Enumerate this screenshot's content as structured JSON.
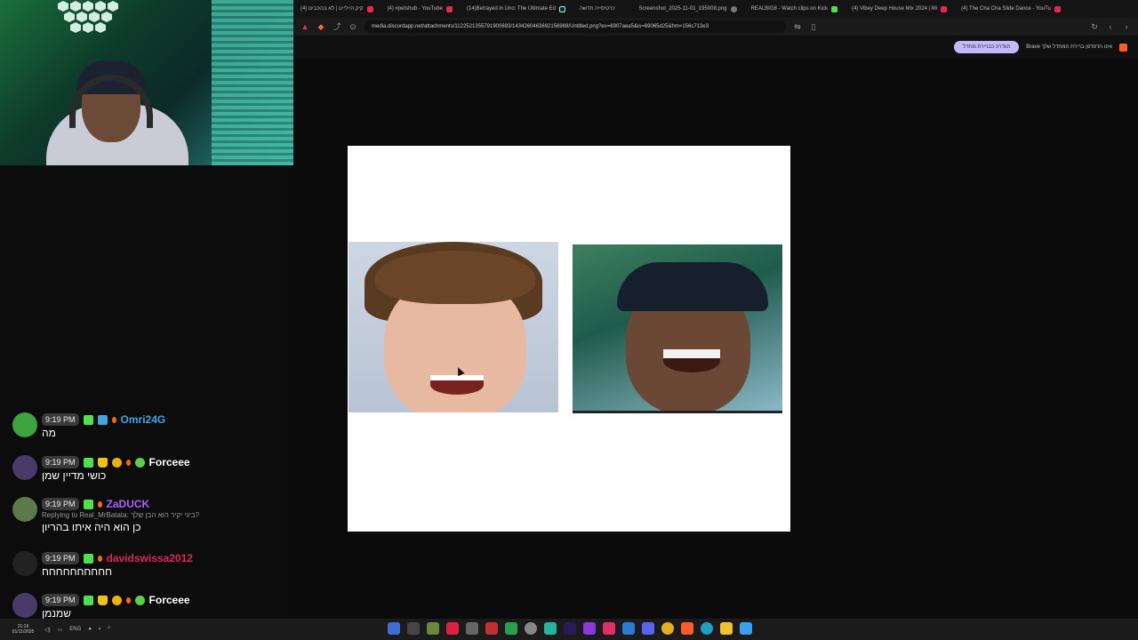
{
  "browser": {
    "tabs": [
      {
        "label": "קיק היילייט | לא בכוכבים (4)",
        "icon": "youtube-icon",
        "fav": "yt"
      },
      {
        "label": "(4) #petshub - YouTube",
        "icon": "youtube-icon",
        "fav": "yt"
      },
      {
        "label": "(14)Betrayed in Uno: The Ultimate Ed",
        "icon": "tiktok-icon",
        "fav": "tiktok"
      },
      {
        "label": "כרטיסייה חדשה",
        "icon": "blank-icon",
        "fav": "none"
      },
      {
        "label": "Screenshot_2025-11-01_195008.png",
        "icon": "image-icon",
        "fav": "img"
      },
      {
        "label": "REALBIG8 - Watch clips on Kick",
        "icon": "kick-icon",
        "fav": "kick"
      },
      {
        "label": "(4) Vibey Deep House Mix 2024 | Mi",
        "icon": "youtube-icon",
        "fav": "yt"
      },
      {
        "label": "(4) The Cha Cha Slide Dance - YouTu",
        "icon": "youtube-icon",
        "fav": "yt"
      }
    ],
    "url": "media.discordapp.net/attachments/1122521355791900693/1434260463692156988/Untitled.png?ex=6907aea5&is=69065d25&hm=156c713e3",
    "infobar": {
      "button_label": "הגדרה כברירת מחדל",
      "message": "Brave אינו הדפדפן ברירת המחדל שלך"
    }
  },
  "chat": {
    "messages": [
      {
        "time": "9:19 PM",
        "username": "Omri24G",
        "user_color": "#3fa6e0",
        "badges": [
          "k",
          "blue",
          "drop"
        ],
        "text": "מה",
        "reply": "",
        "avatar_color": "#3da33d"
      },
      {
        "time": "9:19 PM",
        "username": "Forceee",
        "user_color": "#ffffff",
        "badges": [
          "k",
          "crown",
          "gold",
          "drop",
          "verify"
        ],
        "text": "כושי מדיין שמן",
        "reply": "",
        "avatar_color": "#4a3a6a"
      },
      {
        "time": "9:19 PM",
        "username": "ZaDUCK",
        "user_color": "#b05cff",
        "badges": [
          "k",
          "drop"
        ],
        "text": "כן הוא היה איתו בהריון",
        "reply": "Replying to Real_MrBatata: ביגי יקיר הוא הבן שלך?",
        "avatar_color": "#5a7a4a"
      },
      {
        "time": "9:19 PM",
        "username": "davidswissa2012",
        "user_color": "#e0245e",
        "badges": [
          "k",
          "drop"
        ],
        "text": "חחחחחחחחחח",
        "reply": "",
        "avatar_color": "#222222"
      },
      {
        "time": "9:19 PM",
        "username": "Forceee",
        "user_color": "#ffffff",
        "badges": [
          "k",
          "crown",
          "gold",
          "drop",
          "verify"
        ],
        "text": "שמנמן",
        "reply": "",
        "avatar_color": "#4a3a6a"
      }
    ]
  },
  "taskbar": {
    "time": "21:19",
    "date": "01/11/2025",
    "language": "ENG"
  }
}
